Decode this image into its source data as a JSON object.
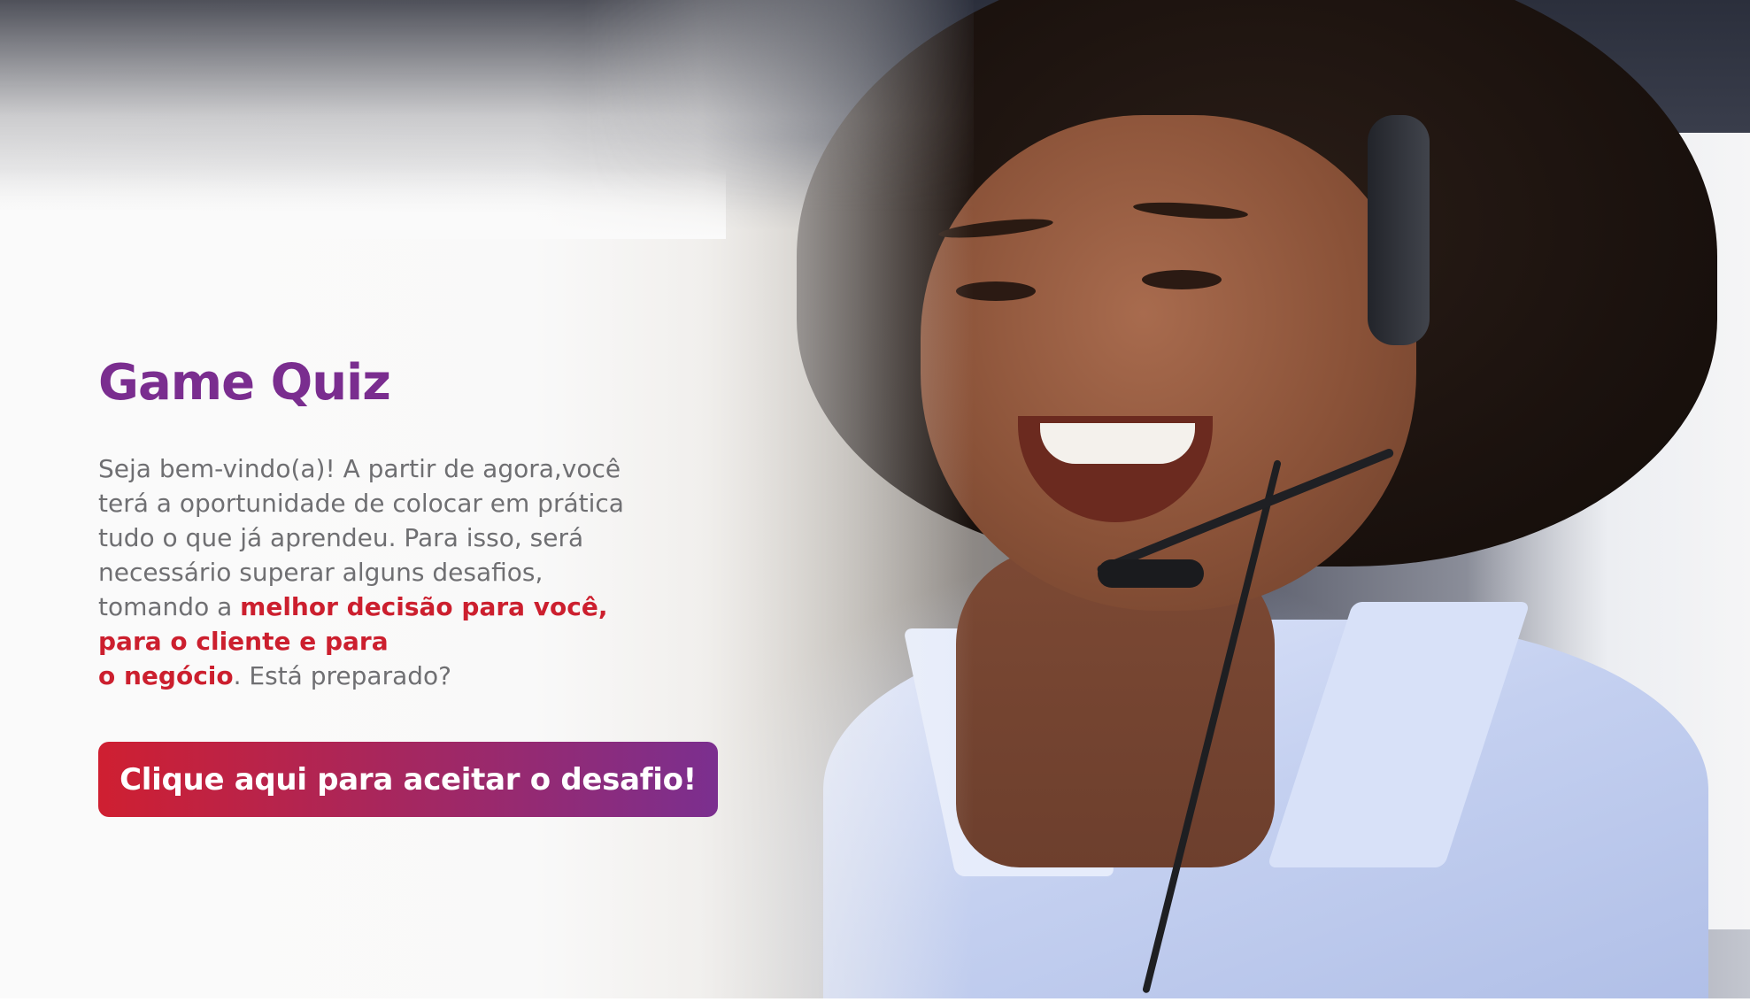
{
  "game": {
    "title": "Game Quiz",
    "intro_line1": "Seja bem-vindo(a)! A partir de agora,você",
    "intro_line2": "terá a oportunidade de colocar em prática",
    "intro_line3": "tudo o que já aprendeu. Para isso, será",
    "intro_line4": "necessário superar alguns desafios,",
    "intro_line5_prefix": "tomando a ",
    "highlight_1": "melhor decisão para você,",
    "highlight_2": "para o cliente e para",
    "highlight_3": "o negócio",
    "intro_suffix": ". Está preparado?",
    "cta_label": "Clique aqui para aceitar o desafio!"
  },
  "colors": {
    "title": "#7a2d8f",
    "highlight": "#cc1f2e",
    "body_text": "#6f6f72",
    "cta_gradient_start": "#cf1f31",
    "cta_gradient_end": "#7b2f8f"
  },
  "background_image": {
    "subject": "smiling woman with headset call center",
    "icon": "photo"
  }
}
